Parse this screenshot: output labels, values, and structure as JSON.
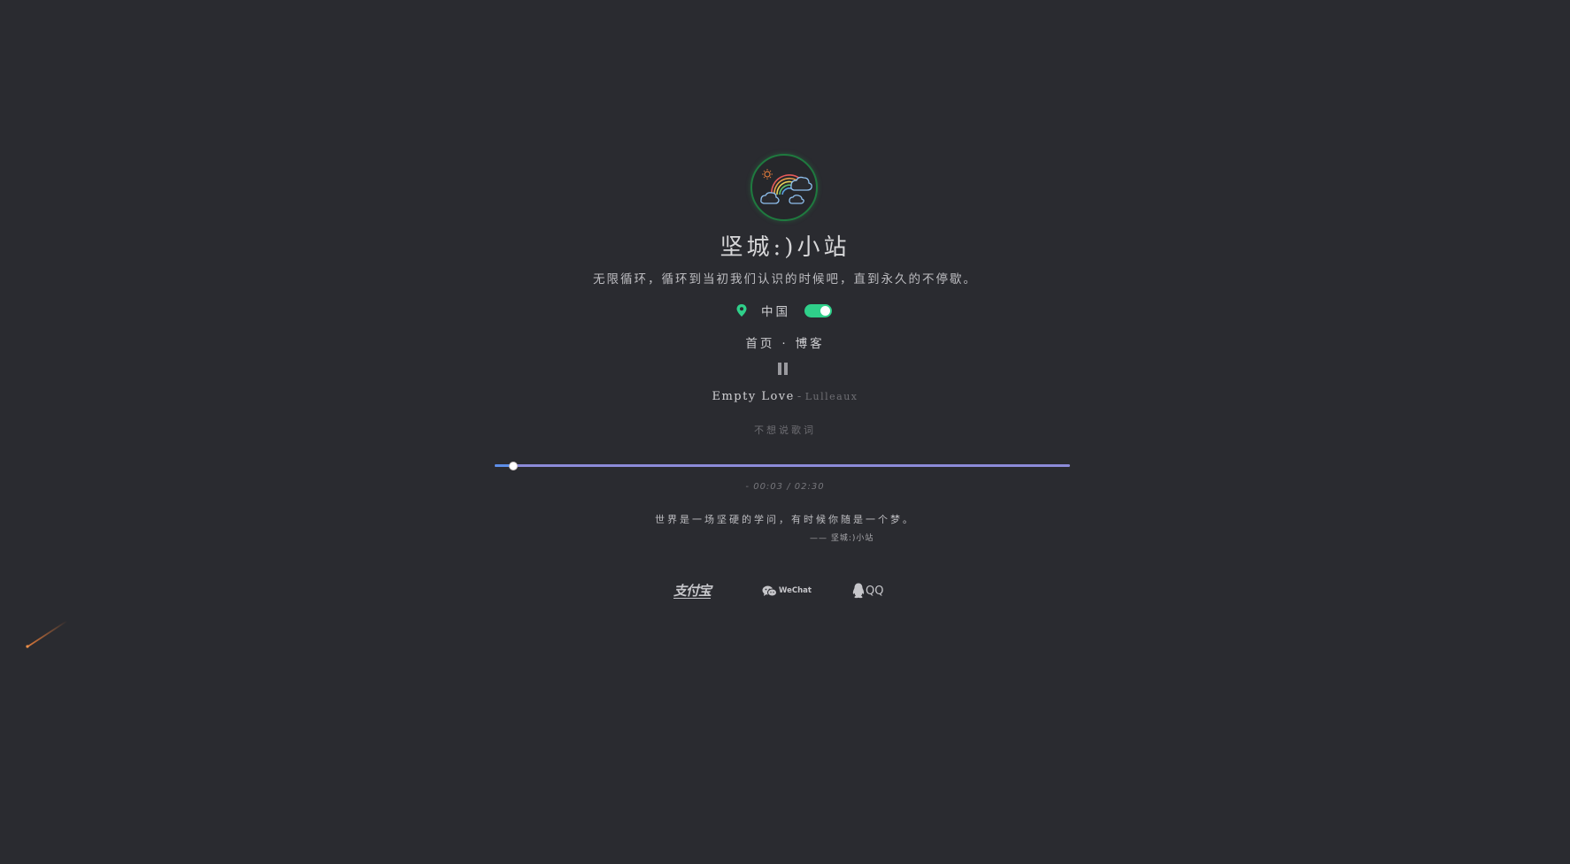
{
  "site": {
    "title": "坚城:)小站",
    "subtitle": "无限循环，循环到当初我们认识的时候吧，直到永久的不停歇。",
    "location": "中国",
    "theme_toggle_on": true
  },
  "nav": {
    "home": "首页",
    "separator": "·",
    "blog": "博客"
  },
  "player": {
    "song_name": "Empty Love",
    "separator": "-",
    "artist": "Lulleaux",
    "lyric": "不想说歌词",
    "progress_fraction": 0.03,
    "time": "- 00:03 / 02:30"
  },
  "quote": {
    "text": "世界是一场坚硬的学问，有时候你随是一个梦。",
    "author": "—— 坚城:)小站"
  },
  "donate": {
    "alipay_label": "支付宝",
    "wechat_label": "WeChat",
    "qq_label": "QQ"
  },
  "colors": {
    "background": "#2a2b30",
    "accent_green": "#2fd08a",
    "progress_track": "#8c8bd9"
  },
  "icons": {
    "avatar": "rainbow-clouds-icon",
    "location": "map-pin-icon",
    "play_state": "pause-icon",
    "wechat": "wechat-icon",
    "qq": "qq-penguin-icon"
  }
}
